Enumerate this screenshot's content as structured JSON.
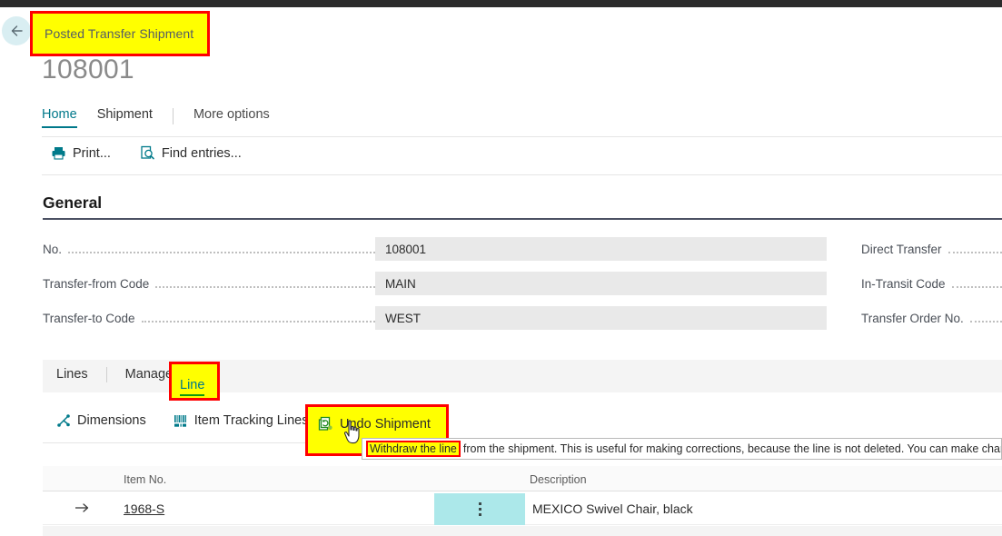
{
  "window": {
    "back_icon": "back-arrow-icon",
    "page_caption": "Posted Transfer Shipment",
    "document_no": "108001"
  },
  "ribbon": {
    "tabs": [
      {
        "label": "Home",
        "active": true
      },
      {
        "label": "Shipment",
        "active": false
      },
      {
        "label": "More options",
        "active": false
      }
    ],
    "actions": [
      {
        "label": "Print...",
        "icon": "printer-icon"
      },
      {
        "label": "Find entries...",
        "icon": "find-entries-icon"
      }
    ]
  },
  "general": {
    "heading": "General",
    "left_fields": [
      {
        "label": "No.",
        "value": "108001"
      },
      {
        "label": "Transfer-from Code",
        "value": "MAIN"
      },
      {
        "label": "Transfer-to Code",
        "value": "WEST"
      }
    ],
    "right_fields": [
      {
        "label": "Direct Transfer"
      },
      {
        "label": "In-Transit Code"
      },
      {
        "label": "Transfer Order No."
      }
    ]
  },
  "lines": {
    "tabs": [
      {
        "label": "Lines",
        "active": false
      },
      {
        "label": "Manage",
        "active": false
      },
      {
        "label": "Line",
        "active": true,
        "highlighted": true
      }
    ],
    "actions": [
      {
        "label": "Dimensions",
        "icon": "dimensions-icon"
      },
      {
        "label": "Item Tracking Lines",
        "icon": "item-tracking-icon"
      },
      {
        "label": "Undo Shipment",
        "icon": "undo-shipment-icon",
        "highlighted": true
      }
    ],
    "tooltip": {
      "highlighted_text": "Withdraw the line",
      "rest_text": "from the shipment. This is useful for making corrections, because the line is not deleted. You can make changes an"
    },
    "table": {
      "columns": [
        "Item No.",
        "Description"
      ],
      "rows": [
        {
          "selected": true,
          "item_no": "1968-S",
          "description": "MEXICO Swivel Chair, black"
        }
      ]
    }
  },
  "colors": {
    "accent_teal": "#00788a",
    "highlight_yellow": "#ffff00",
    "highlight_border_red": "#ff0000",
    "field_bg": "#e9e9e9",
    "selected_cell_teal": "#ace8ea",
    "section_rule": "#4c5163"
  }
}
